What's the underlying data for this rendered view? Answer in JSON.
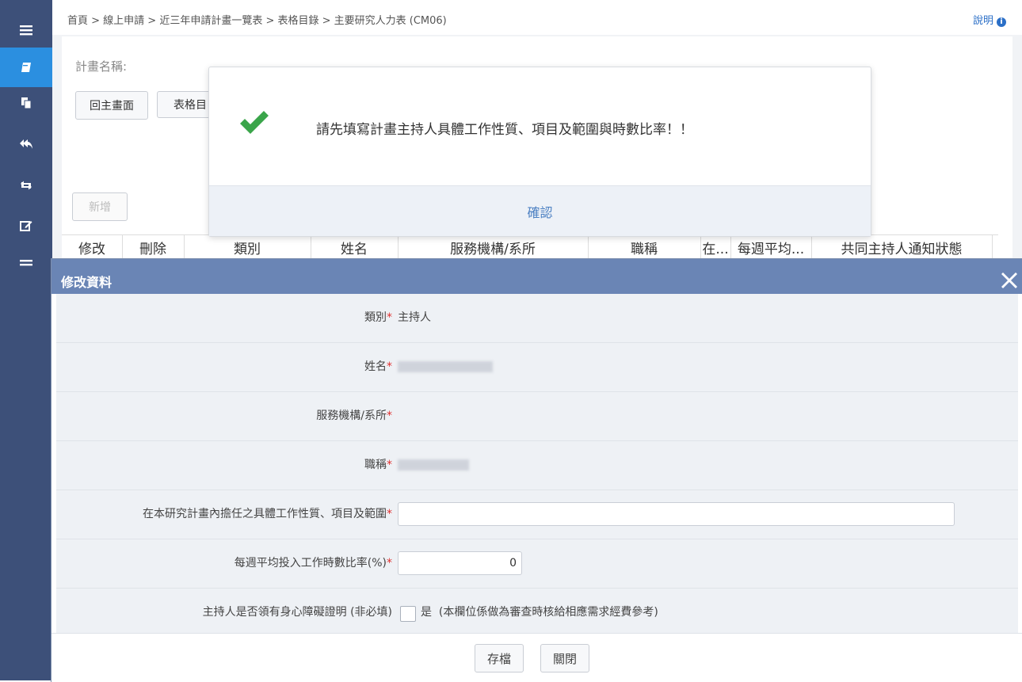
{
  "sidebar": {
    "items": [
      {
        "icon": "menu-icon",
        "glyph": "≡"
      },
      {
        "icon": "book-icon",
        "glyph": "▰"
      },
      {
        "icon": "copy-icon",
        "glyph": "❐"
      },
      {
        "icon": "reply-all-icon",
        "glyph": "↶"
      },
      {
        "icon": "retweet-icon",
        "glyph": "⇄"
      },
      {
        "icon": "edit-icon",
        "glyph": "✎"
      },
      {
        "icon": "equals-icon",
        "glyph": "═"
      }
    ]
  },
  "breadcrumb": "首頁 > 線上申請 > 近三年申請計畫一覽表 > 表格目錄 > 主要研究人力表 (CM06)",
  "help_label": "說明",
  "help_icon": "i",
  "plan_name_label": "計畫名稱:",
  "buttons": {
    "back_main": "回主畫面",
    "form_list": "表格目",
    "add": "新增"
  },
  "table_headers": [
    "修改",
    "刪除",
    "類別",
    "姓名",
    "服務機構/系所",
    "職稱",
    "在...",
    "每週平均...",
    "共同主持人通知狀態"
  ],
  "alert": {
    "message": "請先填寫計畫主持人具體工作性質、項目及範圍與時數比率！！",
    "confirm_label": "確認",
    "success_color": "#3aa54a"
  },
  "modal": {
    "title": "修改資料",
    "fields": {
      "category": {
        "label": "類別",
        "required_mark": "*",
        "value": "主持人"
      },
      "name": {
        "label": "姓名",
        "required_mark": "*"
      },
      "institution": {
        "label": "服務機構/系所",
        "required_mark": "*",
        "value": ""
      },
      "job_title": {
        "label": "職稱",
        "required_mark": "*"
      },
      "work_scope": {
        "label": "在本研究計畫內擔任之具體工作性質、項目及範圍",
        "required_mark": "*",
        "value": ""
      },
      "hours_ratio": {
        "label": "每週平均投入工作時數比率(%)",
        "required_mark": "*",
        "value": "0"
      },
      "disability": {
        "label": "主持人是否領有身心障礙證明 (非必填)",
        "option_label": "是",
        "note": "(本欄位係做為審查時核給相應需求經費參考)",
        "checked": false
      }
    },
    "save_label": "存檔",
    "close_label": "關閉"
  }
}
